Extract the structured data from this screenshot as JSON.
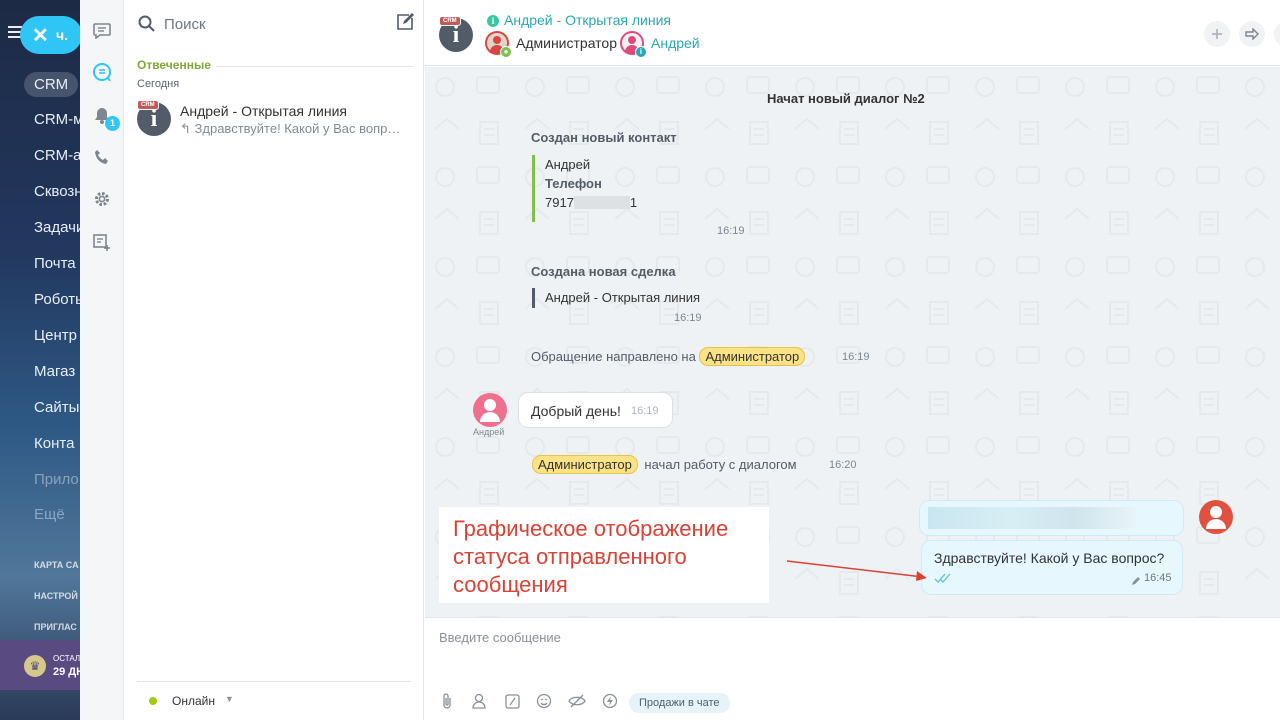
{
  "bitrix_menu": {
    "chat_pill_label": "ч.",
    "items": [
      "CRM",
      "CRM-м",
      "CRM-а",
      "Сквозн",
      "Задачи",
      "Почта",
      "Роботы",
      "Центр",
      "Магаз",
      "Сайты",
      "Конта",
      "Прило",
      "Ещё"
    ],
    "small_items": [
      "КАРТА СА",
      "НАСТРОЙ",
      "ПРИГЛАС"
    ],
    "promo": {
      "line1": "ОСТАЛ",
      "line2": "29 ДН"
    }
  },
  "rail": {
    "notifications_badge": "1"
  },
  "recent": {
    "search_placeholder": "Поиск",
    "section_title": "Отвеченные",
    "date_label": "Сегодня",
    "items": [
      {
        "crm_label": "CRM",
        "name": "Андрей - Открытая линия",
        "last_message": "Здравствуйте! Какой у Вас вопрос?"
      }
    ],
    "status": {
      "label": "Онлайн"
    }
  },
  "dialog": {
    "header": {
      "crm_label": "CRM",
      "title": "Андрей - Открытая линия",
      "participants": [
        {
          "name": "Администратор",
          "color": "#333333"
        },
        {
          "name": "Андрей",
          "color": "#2aa7b0"
        }
      ]
    },
    "messages": {
      "new_dialog": "Начат новый диалог №2",
      "contact_title": "Создан новый контакт",
      "contact_name": "Андрей",
      "contact_phone_label": "Телефон",
      "contact_phone_prefix": "7917",
      "contact_phone_suffix": "1",
      "contact_time": "16:19",
      "deal_title": "Создана новая сделка",
      "deal_name": "Андрей - Открытая линия",
      "deal_time": "16:19",
      "routed_text": "Обращение направлено на",
      "routed_mention": "Администратор",
      "routed_time": "16:19",
      "client_name": "Андрей",
      "client_message": "Добрый день!",
      "client_time": "16:19",
      "operator_mention": "Администратор",
      "operator_text": "начал работу с диалогом",
      "operator_time": "16:20",
      "own_message": "Здравствуйте! Какой у Вас вопрос?",
      "own_time": "16:45"
    },
    "annotation": "Графическое отображение статуса отправленного сообщения",
    "composer": {
      "placeholder": "Введите сообщение",
      "sales_button": "Продажи в чате"
    }
  },
  "colors": {
    "accent": "#2fc6f6",
    "title_teal": "#2aa7b0",
    "section_green": "#7fa834",
    "annotation_red": "#d94236",
    "client_avatar": "#f06f8f",
    "own_avatar": "#e0513f"
  }
}
